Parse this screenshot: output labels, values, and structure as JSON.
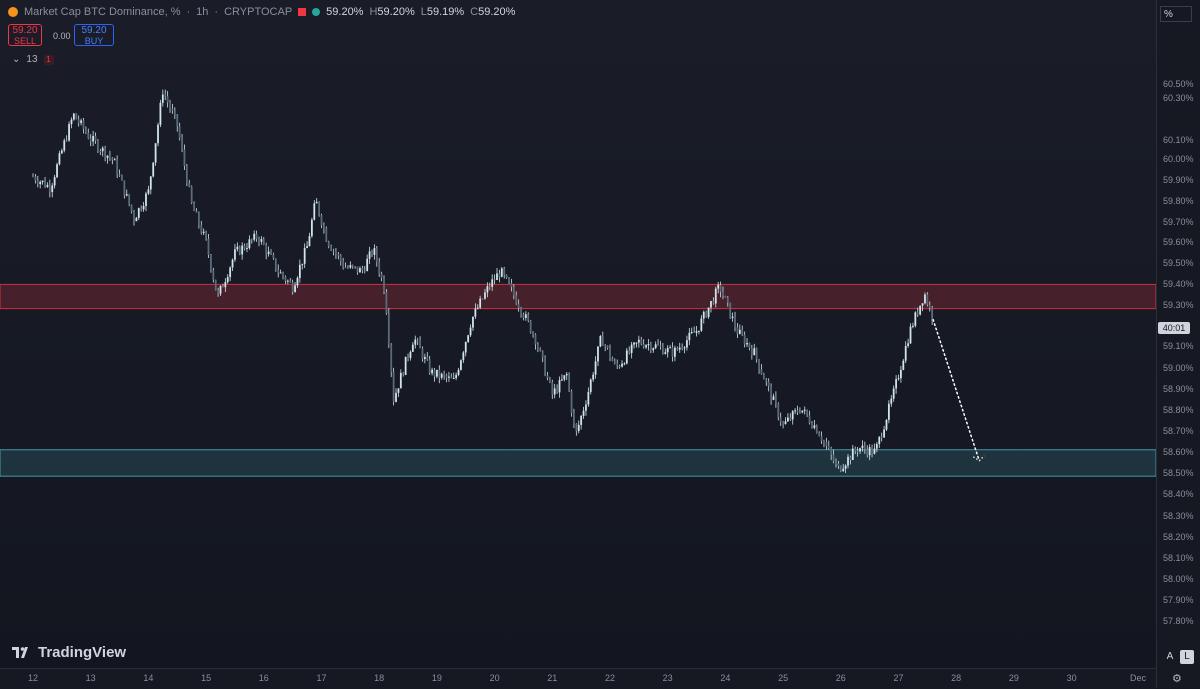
{
  "header": {
    "symbol": "Market Cap BTC Dominance, %",
    "sep": "·",
    "interval": "1h",
    "exchange": "CRYPTOCAP",
    "open": "59.20%",
    "high_label": "H",
    "high": "59.20%",
    "low_label": "L",
    "low": "59.19%",
    "close_label": "C",
    "close": "59.20%"
  },
  "trade": {
    "sell_price": "59.20",
    "sell_label": "SELL",
    "spread": "0.00",
    "buy_price": "59.20",
    "buy_label": "BUY"
  },
  "indicators": {
    "count": "13",
    "badge": "1"
  },
  "axis": {
    "unit": "%",
    "current_time": "40:01",
    "auto_label": "A",
    "log_label": "L"
  },
  "branding": {
    "name": "TradingView"
  },
  "colors": {
    "resistance_zone": "#f23645",
    "support_zone": "#4fb3c4",
    "candle": "#d1e4ea",
    "projection": "#ffffff",
    "background": "#13161f"
  },
  "chart_data": {
    "type": "candlestick",
    "ylim": [
      57.62,
      60.65
    ],
    "y_ticks": [
      "60.50%",
      "60.30%",
      "60.10%",
      "60.00%",
      "59.90%",
      "59.80%",
      "59.70%",
      "59.60%",
      "59.50%",
      "59.40%",
      "59.30%",
      "59.10%",
      "59.00%",
      "58.90%",
      "58.80%",
      "58.70%",
      "58.60%",
      "58.50%",
      "58.40%",
      "58.30%",
      "58.20%",
      "58.10%",
      "58.00%",
      "57.90%",
      "57.80%"
    ],
    "x_ticks": [
      "12",
      "13",
      "14",
      "15",
      "16",
      "17",
      "18",
      "19",
      "20",
      "21",
      "22",
      "23",
      "24",
      "25",
      "26",
      "27",
      "28",
      "29",
      "30",
      "Dec"
    ],
    "zones": [
      {
        "name": "resistance",
        "y_from": 59.25,
        "y_to": 59.36
      },
      {
        "name": "support",
        "y_from": 58.49,
        "y_to": 58.61
      }
    ],
    "price_path": [
      {
        "day": 12.0,
        "v": 59.85
      },
      {
        "day": 12.3,
        "v": 59.8
      },
      {
        "day": 12.7,
        "v": 60.13
      },
      {
        "day": 13.0,
        "v": 60.02
      },
      {
        "day": 13.4,
        "v": 59.92
      },
      {
        "day": 13.75,
        "v": 59.66
      },
      {
        "day": 14.0,
        "v": 59.78
      },
      {
        "day": 14.25,
        "v": 60.24
      },
      {
        "day": 14.5,
        "v": 60.08
      },
      {
        "day": 14.75,
        "v": 59.72
      },
      {
        "day": 15.0,
        "v": 59.55
      },
      {
        "day": 15.2,
        "v": 59.3
      },
      {
        "day": 15.5,
        "v": 59.5
      },
      {
        "day": 15.9,
        "v": 59.58
      },
      {
        "day": 16.25,
        "v": 59.42
      },
      {
        "day": 16.5,
        "v": 59.35
      },
      {
        "day": 16.75,
        "v": 59.53
      },
      {
        "day": 16.9,
        "v": 59.74
      },
      {
        "day": 17.1,
        "v": 59.56
      },
      {
        "day": 17.4,
        "v": 59.44
      },
      {
        "day": 17.7,
        "v": 59.42
      },
      {
        "day": 17.9,
        "v": 59.52
      },
      {
        "day": 18.1,
        "v": 59.33
      },
      {
        "day": 18.25,
        "v": 58.84
      },
      {
        "day": 18.6,
        "v": 59.12
      },
      {
        "day": 18.9,
        "v": 58.96
      },
      {
        "day": 19.3,
        "v": 58.92
      },
      {
        "day": 19.6,
        "v": 59.2
      },
      {
        "day": 19.9,
        "v": 59.35
      },
      {
        "day": 20.1,
        "v": 59.42
      },
      {
        "day": 20.4,
        "v": 59.28
      },
      {
        "day": 20.7,
        "v": 59.12
      },
      {
        "day": 21.0,
        "v": 58.86
      },
      {
        "day": 21.25,
        "v": 58.95
      },
      {
        "day": 21.4,
        "v": 58.67
      },
      {
        "day": 21.6,
        "v": 58.85
      },
      {
        "day": 21.85,
        "v": 59.12
      },
      {
        "day": 22.1,
        "v": 58.98
      },
      {
        "day": 22.5,
        "v": 59.1
      },
      {
        "day": 22.8,
        "v": 59.08
      },
      {
        "day": 23.1,
        "v": 59.05
      },
      {
        "day": 23.5,
        "v": 59.15
      },
      {
        "day": 23.9,
        "v": 59.35
      },
      {
        "day": 24.2,
        "v": 59.15
      },
      {
        "day": 24.5,
        "v": 59.05
      },
      {
        "day": 24.8,
        "v": 58.85
      },
      {
        "day": 25.0,
        "v": 58.72
      },
      {
        "day": 25.3,
        "v": 58.8
      },
      {
        "day": 25.6,
        "v": 58.7
      },
      {
        "day": 25.95,
        "v": 58.52
      },
      {
        "day": 26.3,
        "v": 58.62
      },
      {
        "day": 26.6,
        "v": 58.6
      },
      {
        "day": 26.9,
        "v": 58.85
      },
      {
        "day": 27.2,
        "v": 59.15
      },
      {
        "day": 27.45,
        "v": 59.32
      },
      {
        "day": 27.6,
        "v": 59.2
      }
    ],
    "projection": {
      "from_day": 27.6,
      "from_v": 59.2,
      "to_day": 28.4,
      "to_v": 58.56
    }
  }
}
